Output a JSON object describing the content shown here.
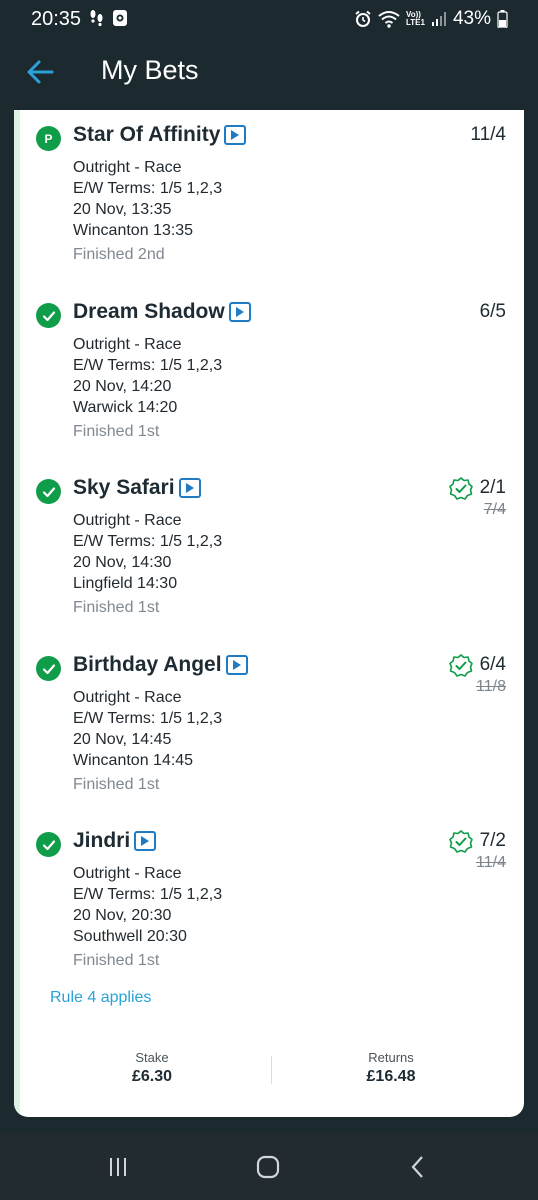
{
  "status_bar": {
    "time": "20:35",
    "battery": "43%",
    "icons": [
      "steps-icon",
      "screen-record-icon",
      "alarm-icon",
      "wifi-icon",
      "volte-icon",
      "signal-icon",
      "battery-icon"
    ],
    "volte_label": "Vo))",
    "lte_label": "LTE1"
  },
  "header": {
    "title": "My Bets"
  },
  "selections": [
    {
      "horse": "Star Of Affinity",
      "status": "placed",
      "status_letter": "P",
      "market": "Outright - Race",
      "ew_terms": "E/W Terms: 1/5 1,2,3",
      "time": "20 Nov, 13:35",
      "venue": "Wincanton 13:35",
      "result": "Finished 2nd",
      "odds": "11/4",
      "old_odds": "",
      "boosted": false
    },
    {
      "horse": "Dream Shadow",
      "status": "won",
      "status_letter": "",
      "market": "Outright - Race",
      "ew_terms": "E/W Terms: 1/5 1,2,3",
      "time": "20 Nov, 14:20",
      "venue": "Warwick 14:20",
      "result": "Finished 1st",
      "odds": "6/5",
      "old_odds": "",
      "boosted": false
    },
    {
      "horse": "Sky Safari",
      "status": "won",
      "status_letter": "",
      "market": "Outright - Race",
      "ew_terms": "E/W Terms: 1/5 1,2,3",
      "time": "20 Nov, 14:30",
      "venue": "Lingfield 14:30",
      "result": "Finished 1st",
      "odds": "2/1",
      "old_odds": "7/4",
      "boosted": true
    },
    {
      "horse": "Birthday Angel",
      "status": "won",
      "status_letter": "",
      "market": "Outright - Race",
      "ew_terms": "E/W Terms: 1/5 1,2,3",
      "time": "20 Nov, 14:45",
      "venue": "Wincanton 14:45",
      "result": "Finished 1st",
      "odds": "6/4",
      "old_odds": "11/8",
      "boosted": true
    },
    {
      "horse": "Jindri",
      "status": "won",
      "status_letter": "",
      "market": "Outright - Race",
      "ew_terms": "E/W Terms: 1/5 1,2,3",
      "time": "20 Nov, 20:30",
      "venue": "Southwell 20:30",
      "result": "Finished 1st",
      "odds": "7/2",
      "old_odds": "11/4",
      "boosted": true
    }
  ],
  "rule4": "Rule 4 applies",
  "totals": {
    "stake_label": "Stake",
    "stake_value": "£6.30",
    "returns_label": "Returns",
    "returns_value": "£16.48"
  },
  "colors": {
    "accent_green": "#0f9d4a",
    "link_blue": "#2aa2d8",
    "header_bg": "#1c2a30",
    "back_arrow": "#2aa2d8"
  }
}
